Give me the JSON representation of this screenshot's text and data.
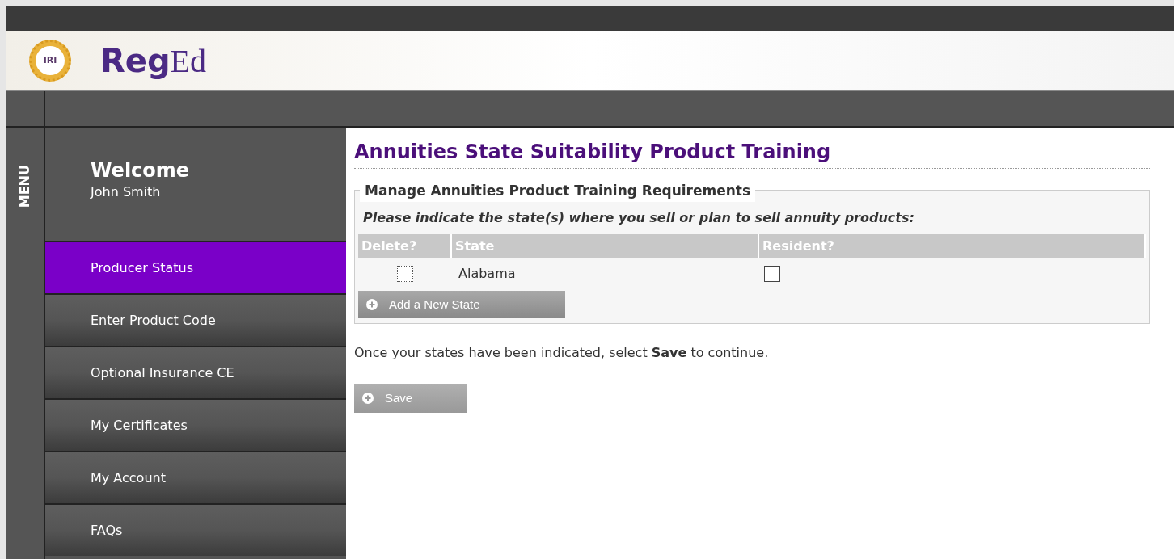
{
  "header": {
    "badge": "IRI",
    "wordmark_bold": "Reg",
    "wordmark_light": "Ed"
  },
  "menu_label": "MENU",
  "welcome": {
    "title": "Welcome",
    "user": "John Smith"
  },
  "sidebar": {
    "items": [
      {
        "label": "Producer Status",
        "selected": true
      },
      {
        "label": "Enter Product Code",
        "selected": false
      },
      {
        "label": "Optional Insurance CE",
        "selected": false
      },
      {
        "label": "My Certificates",
        "selected": false
      },
      {
        "label": "My Account",
        "selected": false
      },
      {
        "label": "FAQs",
        "selected": false
      }
    ]
  },
  "page_title": "Annuities State Suitability Product Training",
  "fieldset": {
    "legend": "Manage Annuities Product Training Requirements",
    "instruction": "Please indicate the state(s) where you sell or plan to sell annuity products:"
  },
  "table": {
    "columns": [
      "Delete?",
      "State",
      "Resident?"
    ],
    "rows": [
      {
        "delete_checked": false,
        "state": "Alabama",
        "resident_checked": false
      }
    ]
  },
  "add_button": "Add a New State",
  "note": "Once your states have been indicated, select **Save** to continue.",
  "save_button": "Save"
}
